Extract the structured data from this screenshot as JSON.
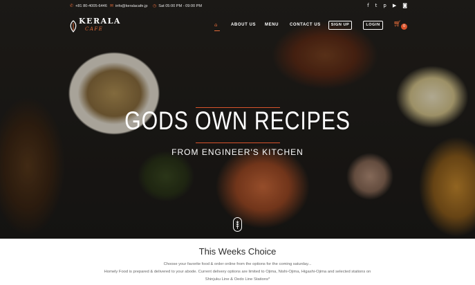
{
  "topbar": {
    "phone": "+81 80-4005-6446",
    "email": "info@keralacafe.jp",
    "hours": "Sat 05:00 PM - 09:00 PM",
    "social_icons": [
      "facebook-icon",
      "twitter-icon",
      "pinterest-icon",
      "youtube-icon",
      "instagram-icon"
    ],
    "accent_color": "#e26b3a"
  },
  "logo": {
    "name": "KERALA",
    "sub": "CAFE"
  },
  "nav": {
    "home_icon": "home-icon",
    "items": [
      "ABOUT US",
      "MENU",
      "CONTACT US"
    ],
    "signup": "SIGN UP",
    "login": "LOGIN",
    "cart_icon": "cart-icon",
    "cart_count": "0"
  },
  "hero": {
    "title": "GODS OWN RECIPES",
    "subtitle": "FROM ENGINEER'S KITCHEN",
    "scroll_icon": "scroll-down-icon"
  },
  "section": {
    "title": "This Weeks Choice",
    "line1": "Choose your  favorite food & order online from the options for the coming saturday...",
    "line2": "Homely Food is prepared & delivered to your abode. Current delivery options are limited to Ojima, Nishi-Ojima, Higashi-Ojima and selected stations on",
    "line3": "Shinjuku Line & Oedo Line Stations*"
  }
}
